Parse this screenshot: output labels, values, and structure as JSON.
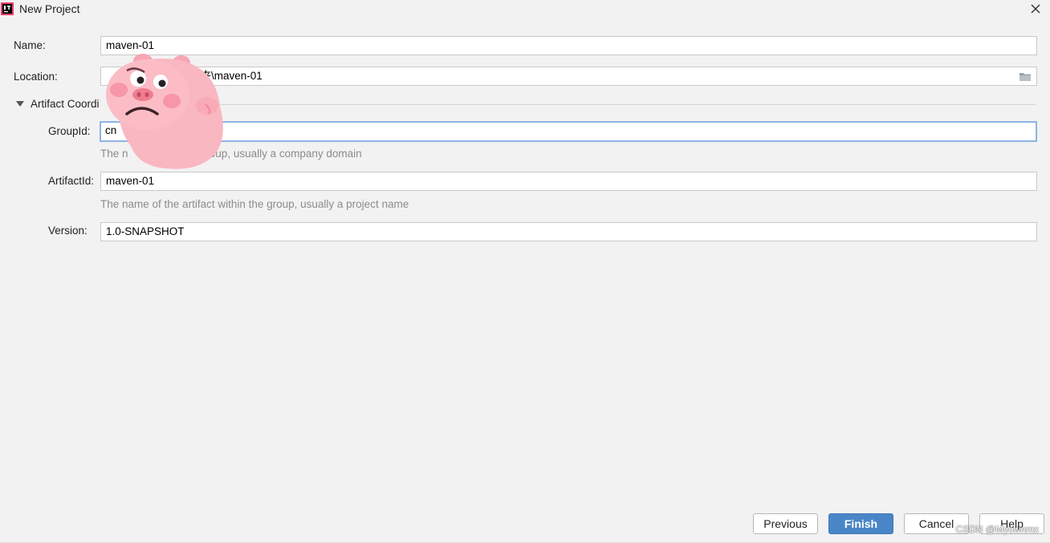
{
  "window": {
    "title": "New Project",
    "app_icon": "intellij-idea-icon",
    "close_icon": "close-icon"
  },
  "form": {
    "name_label": "Name:",
    "name_value": "maven-01",
    "location_label": "Location:",
    "location_value": "件夹\\maven-01",
    "folder_icon": "folder-icon",
    "section_label": "Artifact Coordi",
    "group_label": "GroupId:",
    "group_value": "cn",
    "group_hint": "The n                    ct group, usually a company domain",
    "artifact_label": "ArtifactId:",
    "artifact_value": "maven-01",
    "artifact_hint": "The name of the artifact within the group, usually a project name",
    "version_label": "Version:",
    "version_value": "1.0-SNAPSHOT"
  },
  "buttons": {
    "previous": "Previous",
    "finish": "Finish",
    "cancel": "Cancel",
    "help": "Help"
  },
  "sticker": "pig-sticker",
  "watermark": "CSDN @Myownmx",
  "colors": {
    "background": "#f2f2f2",
    "primary_button": "#4a86c7",
    "focus_border": "#8fb3e6",
    "hint_text": "#8c8c8c"
  }
}
